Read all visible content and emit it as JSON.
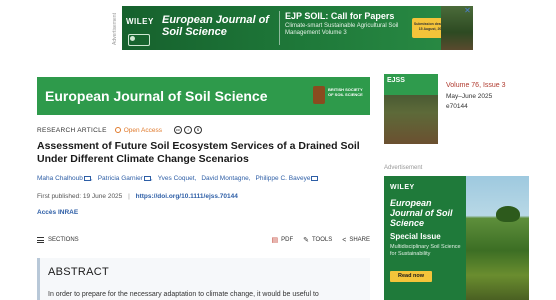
{
  "top_ad": {
    "side_label": "Advertisement",
    "brand": "WILEY",
    "journal": "European Journal of Soil Science",
    "headline": "EJP SOIL: Call for Papers",
    "body": "Climate-smart Sustainable Agricultural Soil Management Volume 3",
    "deadline": "Submission deadline: 15 August, 2025"
  },
  "journal_banner": {
    "title": "European Journal of Soil Science",
    "society_logo_text": "BRITISH SOCIETY OF SOIL SCIENCE"
  },
  "article": {
    "type": "RESEARCH ARTICLE",
    "open_access": "Open Access",
    "license_icons": [
      "cc",
      "by",
      "nc"
    ],
    "title": "Assessment of Future Soil Ecosystem Services of a Drained Soil Under Different Climate Change Scenarios",
    "authors": [
      "Maha Chalhoub",
      "Patricia Garnier",
      "Yves Coquet",
      "David Montagne",
      "Philippe C. Baveye"
    ],
    "authors_with_email": [
      0,
      1,
      4
    ],
    "first_published_label": "First published:",
    "first_published": "19 June 2025",
    "doi": "https://doi.org/10.1111/ejss.70144",
    "access": "Accès INRAE"
  },
  "toolbar": {
    "sections": "SECTIONS",
    "pdf": "PDF",
    "tools": "TOOLS",
    "share": "SHARE"
  },
  "abstract": {
    "heading": "ABSTRACT",
    "first_line": "In order to prepare for the necessary adaptation to climate change, it would be useful to"
  },
  "issue": {
    "cover_title": "EJSS",
    "volume": "Volume 76, Issue 3",
    "date": "May–June 2025",
    "article_id": "e70144"
  },
  "side_ad": {
    "label": "Advertisement",
    "brand": "WILEY",
    "journal": "European Journal of Soil Science",
    "headline": "Special Issue",
    "body": "Multidisciplinary Soil Science for Sustainability",
    "button": "Read now"
  },
  "colors": {
    "brand_green": "#2e9a4b",
    "link_blue": "#2d5ea6",
    "open_access_orange": "#e07a2c",
    "volume_red": "#b03a2e",
    "ad_button_yellow": "#f4c43a"
  }
}
